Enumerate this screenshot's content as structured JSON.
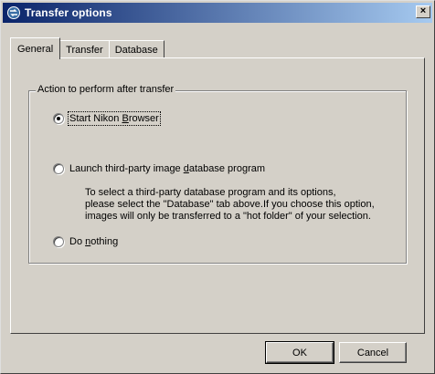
{
  "window": {
    "title": "Transfer options",
    "close_label": "×"
  },
  "tabs": [
    {
      "label": "General",
      "active": true
    },
    {
      "label": "Transfer",
      "active": false
    },
    {
      "label": "Database",
      "active": false
    }
  ],
  "group": {
    "label": "Action to perform after transfer"
  },
  "options": {
    "start_browser": {
      "pre": "Start Nikon ",
      "accel": "B",
      "post": "rowser",
      "selected": true
    },
    "launch_db": {
      "pre": "Launch third-party image ",
      "accel": "d",
      "post": "atabase program",
      "selected": false
    },
    "do_nothing": {
      "pre": "Do ",
      "accel": "n",
      "post": "othing",
      "selected": false
    }
  },
  "description": {
    "line1": "To select a third-party database program and its options,",
    "line2": "please select the \"Database\" tab above.If you choose this option,",
    "line3": "images will only be transferred to a \"hot folder\" of your selection."
  },
  "buttons": {
    "ok": "OK",
    "cancel": "Cancel"
  },
  "icons": {
    "title": "transfer-app-icon"
  },
  "colors": {
    "titlebar_start": "#0a246a",
    "titlebar_end": "#a6caf0",
    "face": "#d4d0c8"
  }
}
